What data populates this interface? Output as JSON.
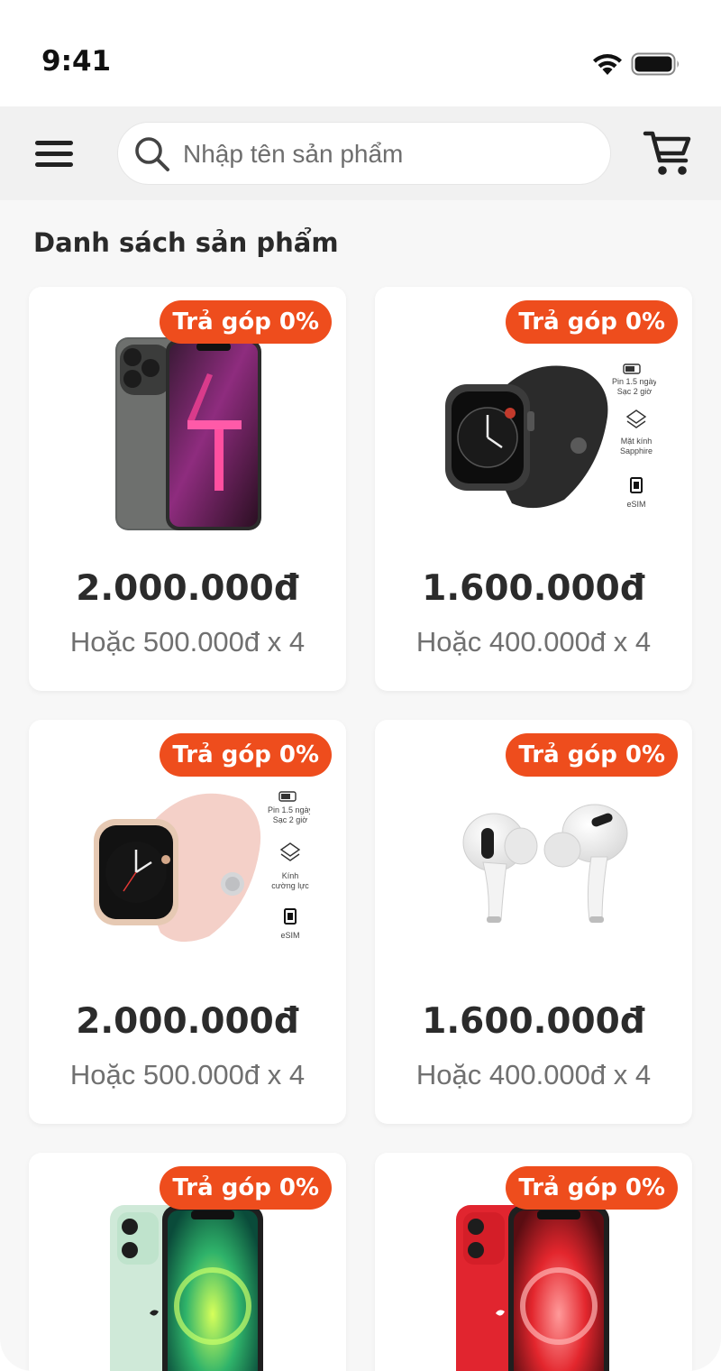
{
  "status_bar": {
    "time": "9:41"
  },
  "header": {
    "search_placeholder": "Nhập tên sản phẩm",
    "menu_icon": "hamburger-menu-icon",
    "search_icon": "search-icon",
    "cart_icon": "shopping-cart-icon"
  },
  "section_title": "Danh sách sản phẩm",
  "colors": {
    "accent": "#ee4d1d",
    "header_bg": "#f1f1f1",
    "page_bg": "#f7f7f7"
  },
  "products": [
    {
      "badge": "Trả góp 0%",
      "image": "iphone-13-pro-graphite",
      "price": "2.000.000đ",
      "installment": "Hoặc 500.000đ x 4"
    },
    {
      "badge": "Trả góp 0%",
      "image": "apple-watch-series-6-black",
      "price": "1.600.000đ",
      "installment": "Hoặc 400.000đ x 4",
      "specs": [
        "Pin 1.5 ngày",
        "Sạc 2 giờ",
        "Mặt kính",
        "Sapphire",
        "eSIM"
      ]
    },
    {
      "badge": "Trả góp 0%",
      "image": "apple-watch-se-pink",
      "price": "2.000.000đ",
      "installment": "Hoặc 500.000đ x 4",
      "specs": [
        "Pin 1.5 ngày",
        "Sạc 2 giờ",
        "Kính",
        "cường lực",
        "eSIM"
      ]
    },
    {
      "badge": "Trả góp 0%",
      "image": "airpods-pro",
      "price": "1.600.000đ",
      "installment": "Hoặc 400.000đ x 4"
    },
    {
      "badge": "Trả góp 0%",
      "image": "iphone-12-green"
    },
    {
      "badge": "Trả góp 0%",
      "image": "iphone-12-red"
    }
  ]
}
